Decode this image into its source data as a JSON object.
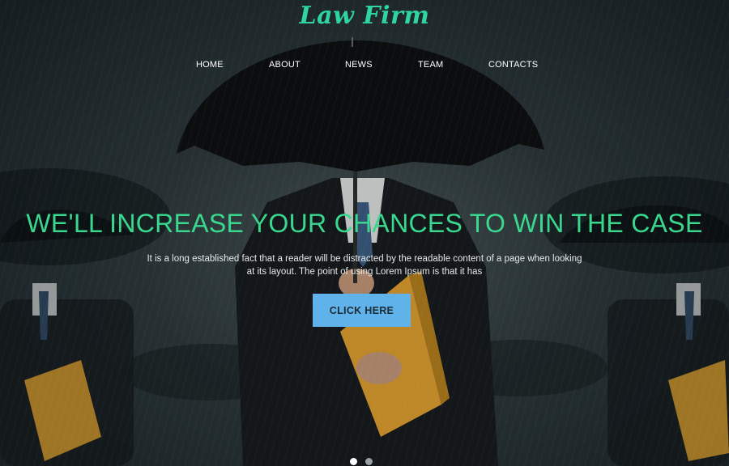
{
  "brand": {
    "logo_text": "Law Firm"
  },
  "nav": {
    "items": [
      {
        "label": "HOME"
      },
      {
        "label": "ABOUT"
      },
      {
        "label": "NEWS"
      },
      {
        "label": "TEAM"
      },
      {
        "label": "CONTACTS"
      }
    ]
  },
  "hero": {
    "headline": "WE'LL INCREASE YOUR CHANCES TO WIN THE CASE",
    "body_line1": "It is a long established fact that a reader will be distracted by the readable content of a page when looking",
    "body_line2": "at its layout. The point of using Lorem Ipsum is that it has",
    "cta_label": "CLICK HERE"
  },
  "slider": {
    "slide_count": 2,
    "active_index": 0
  },
  "colors": {
    "accent": "#3ad88f",
    "logo": "#2fd59f",
    "button": "#5fb3ea",
    "nav_text": "#ffffff",
    "dot_active": "#ffffff",
    "dot_inactive": "#9aa0a3"
  },
  "icons": {
    "slider_dot": "slider-dot-icon"
  }
}
